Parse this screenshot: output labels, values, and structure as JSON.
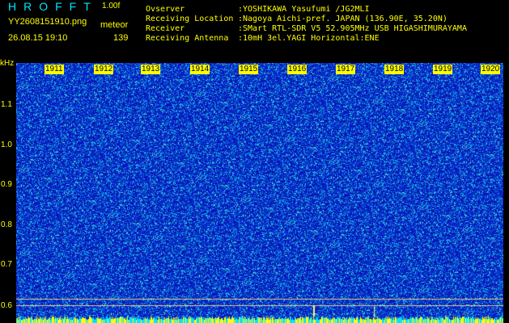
{
  "header": {
    "app_title": "HROFFT",
    "version": "1.00f",
    "filename": "YY2608151910.png",
    "mode": "meteor",
    "datetime": "26.08.15 19:10",
    "count": "139"
  },
  "info": [
    {
      "label": "Ovserver",
      "value": ":YOSHIKAWA Yasufumi /JG2MLI"
    },
    {
      "label": "Receiving Location",
      "value": ":Nagoya Aichi-pref. JAPAN (136.90E, 35.20N)"
    },
    {
      "label": "Receiver",
      "value": ":SMart RTL-SDR V5 52.905MHz USB HIGASHIMURAYAMA"
    },
    {
      "label": "Receiving Antenna",
      "value": ":10mH 3el.YAGI Horizontal:ENE"
    }
  ],
  "axis": {
    "unit": "kHz",
    "ticks": [
      "1.1",
      "1.0",
      "0.9",
      "0.8",
      "0.7",
      "0.6"
    ]
  },
  "time_marks": [
    "1911",
    "1912",
    "1913",
    "1914",
    "1915",
    "1916",
    "1917",
    "1918",
    "1919",
    "1920"
  ],
  "colors": {
    "text": "#ffff00",
    "title": "#00e5ff",
    "noise_bg": "#0a1bb4"
  }
}
